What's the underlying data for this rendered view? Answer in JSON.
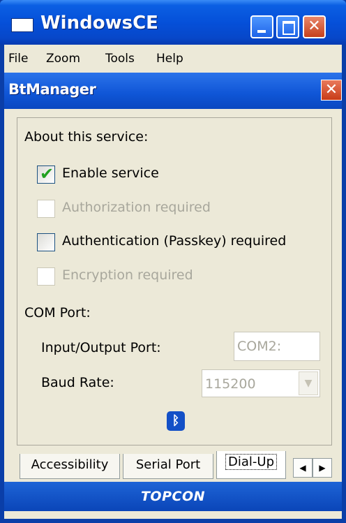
{
  "window": {
    "title": "WindowsCE",
    "minimize_icon": "minimize-icon",
    "maximize_icon": "maximize-icon",
    "close_glyph": "✕"
  },
  "menu": {
    "items": [
      "File",
      "Zoom",
      "Tools",
      "Help"
    ]
  },
  "dialog": {
    "title": "BtManager",
    "close_glyph": "✕"
  },
  "service": {
    "heading": "About this service:",
    "enable": {
      "label": "Enable service",
      "checked": true,
      "enabled": true
    },
    "authorization": {
      "label": "Authorization required",
      "checked": false,
      "enabled": false
    },
    "authentication": {
      "label": "Authentication (Passkey) required",
      "checked": false,
      "enabled": true
    },
    "encryption": {
      "label": "Encryption required",
      "checked": false,
      "enabled": false
    },
    "check_glyph": "✔"
  },
  "com_port": {
    "heading": "COM Port:",
    "io_label": "Input/Output Port:",
    "io_value": "COM2:",
    "baud_label": "Baud Rate:",
    "baud_value": "115200",
    "dropdown_glyph": "▼"
  },
  "bluetooth_glyph": "ᛒ",
  "tabs": {
    "items": [
      "Accessibility",
      "Serial Port",
      "Dial-Up"
    ],
    "active_index": 2,
    "left_arrow": "◀",
    "right_arrow": "▶"
  },
  "brand": {
    "text": "TOPCON"
  },
  "colors": {
    "titlebar": "#0550d9",
    "dialog_bg": "#ece9d8",
    "check_green": "#21a121",
    "disabled_text": "#a8a79c"
  }
}
